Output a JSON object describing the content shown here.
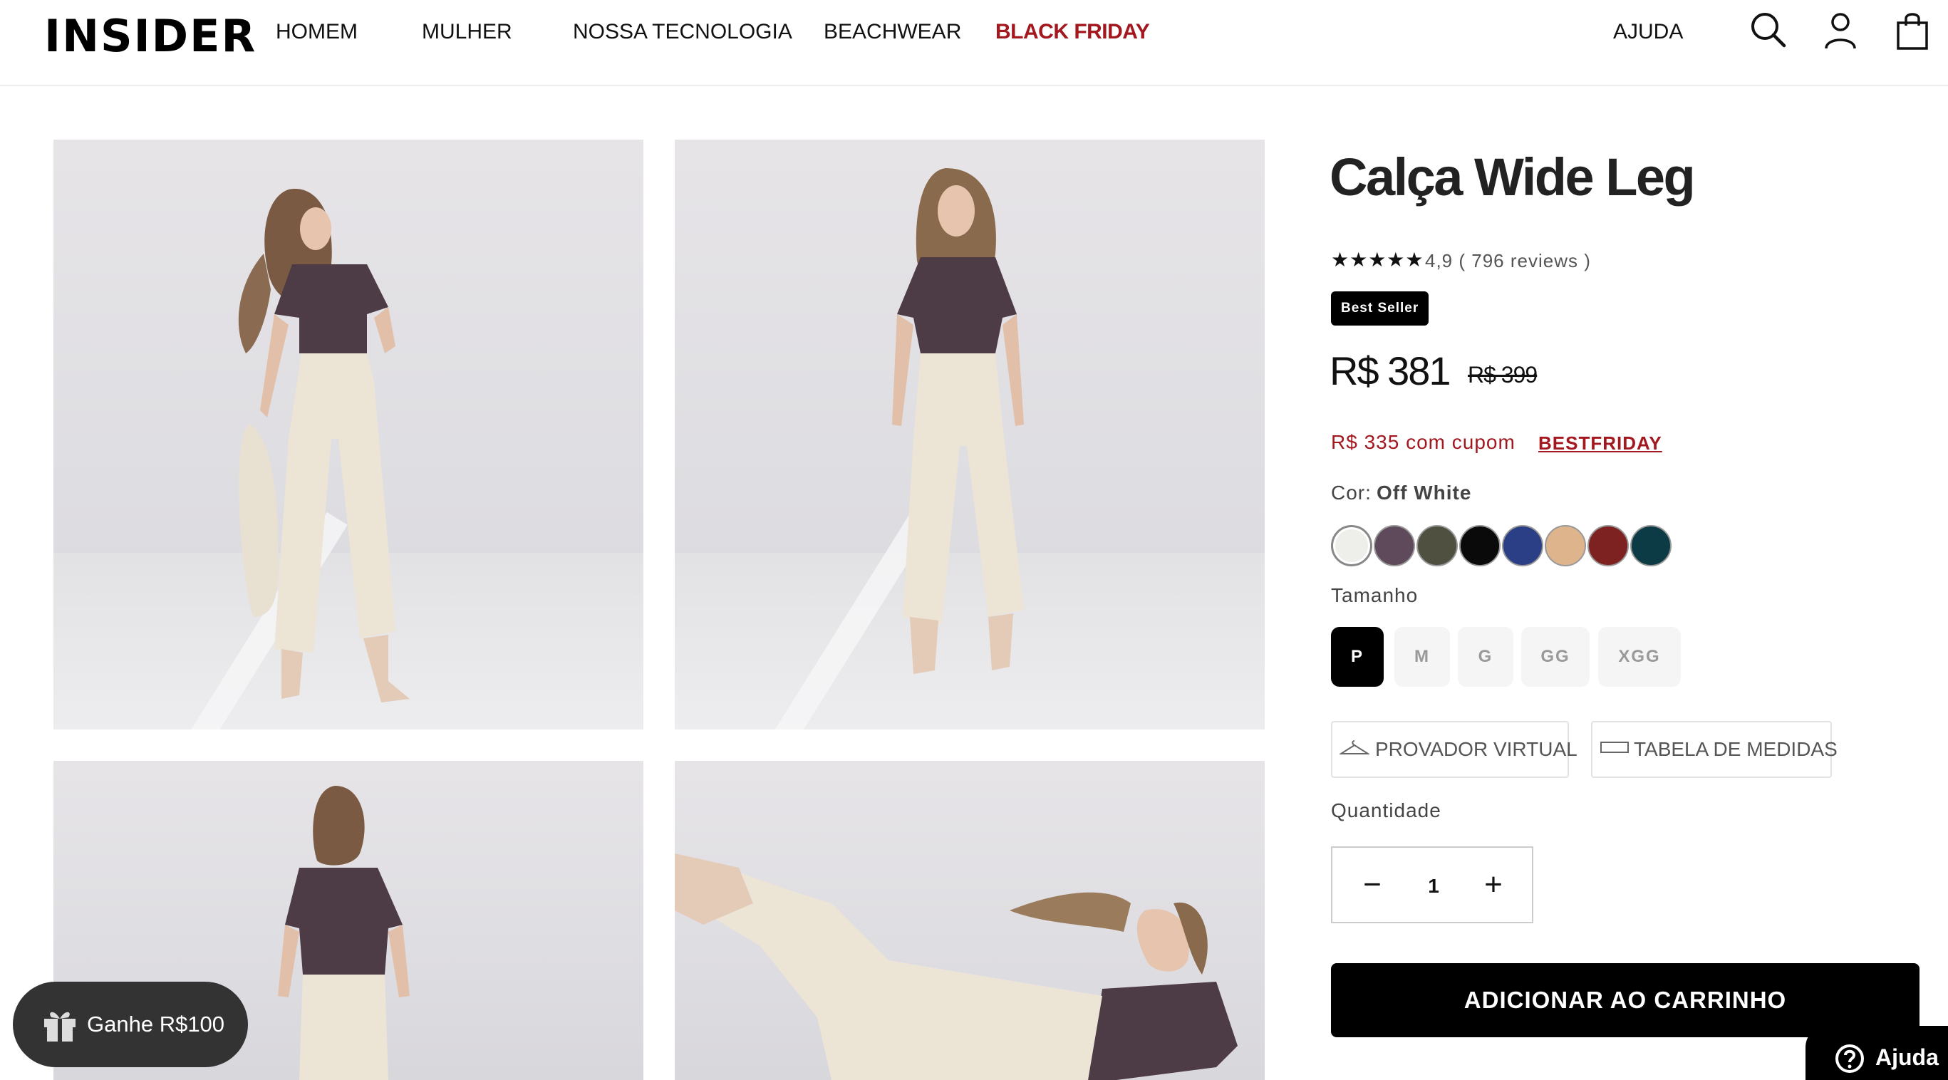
{
  "header": {
    "logo": "INSIDER",
    "nav": [
      {
        "label": "HOMEM"
      },
      {
        "label": "MULHER"
      },
      {
        "label": "NOSSA TECNOLOGIA"
      },
      {
        "label": "BEACHWEAR"
      },
      {
        "label": "BLACK FRIDAY",
        "color": "#a3171f"
      }
    ],
    "help": "AJUDA",
    "icons": [
      "search-icon",
      "user-icon",
      "bag-icon"
    ]
  },
  "gallery": {
    "images": [
      "model-front-turned",
      "model-front",
      "model-back",
      "model-jumping"
    ]
  },
  "product": {
    "title": "Calça Wide Leg",
    "stars": "★★★★★",
    "rating": "4,9 ( 796 reviews )",
    "badge": "Best Seller",
    "price": "R$ 381",
    "old_price": "R$ 399",
    "coupon_text": "R$ 335 com cupom",
    "coupon_code": "BESTFRIDAY",
    "color_label": "Cor:",
    "color_value": "Off White",
    "swatches": [
      "#eeeeea",
      "#5e4a5a",
      "#4f5040",
      "#0a0a0a",
      "#2b3f86",
      "#ddb48c",
      "#7d2220",
      "#0d3b45"
    ],
    "size_label": "Tamanho",
    "sizes": [
      {
        "label": "P",
        "selected": true
      },
      {
        "label": "M"
      },
      {
        "label": "G"
      },
      {
        "label": "GG"
      },
      {
        "label": "XGG"
      }
    ],
    "virtual_fit": "PROVADOR VIRTUAL",
    "size_chart": "TABELA DE MEDIDAS",
    "qty_label": "Quantidade",
    "qty_minus": "−",
    "qty_value": "1",
    "qty_plus": "+",
    "add_to_cart": "ADICIONAR AO CARRINHO"
  },
  "promo": {
    "gift": "Ganhe R$100"
  },
  "help_widget": {
    "label": "Ajuda"
  },
  "colors": {
    "accent": "#a3171f",
    "primary": "#000000"
  }
}
